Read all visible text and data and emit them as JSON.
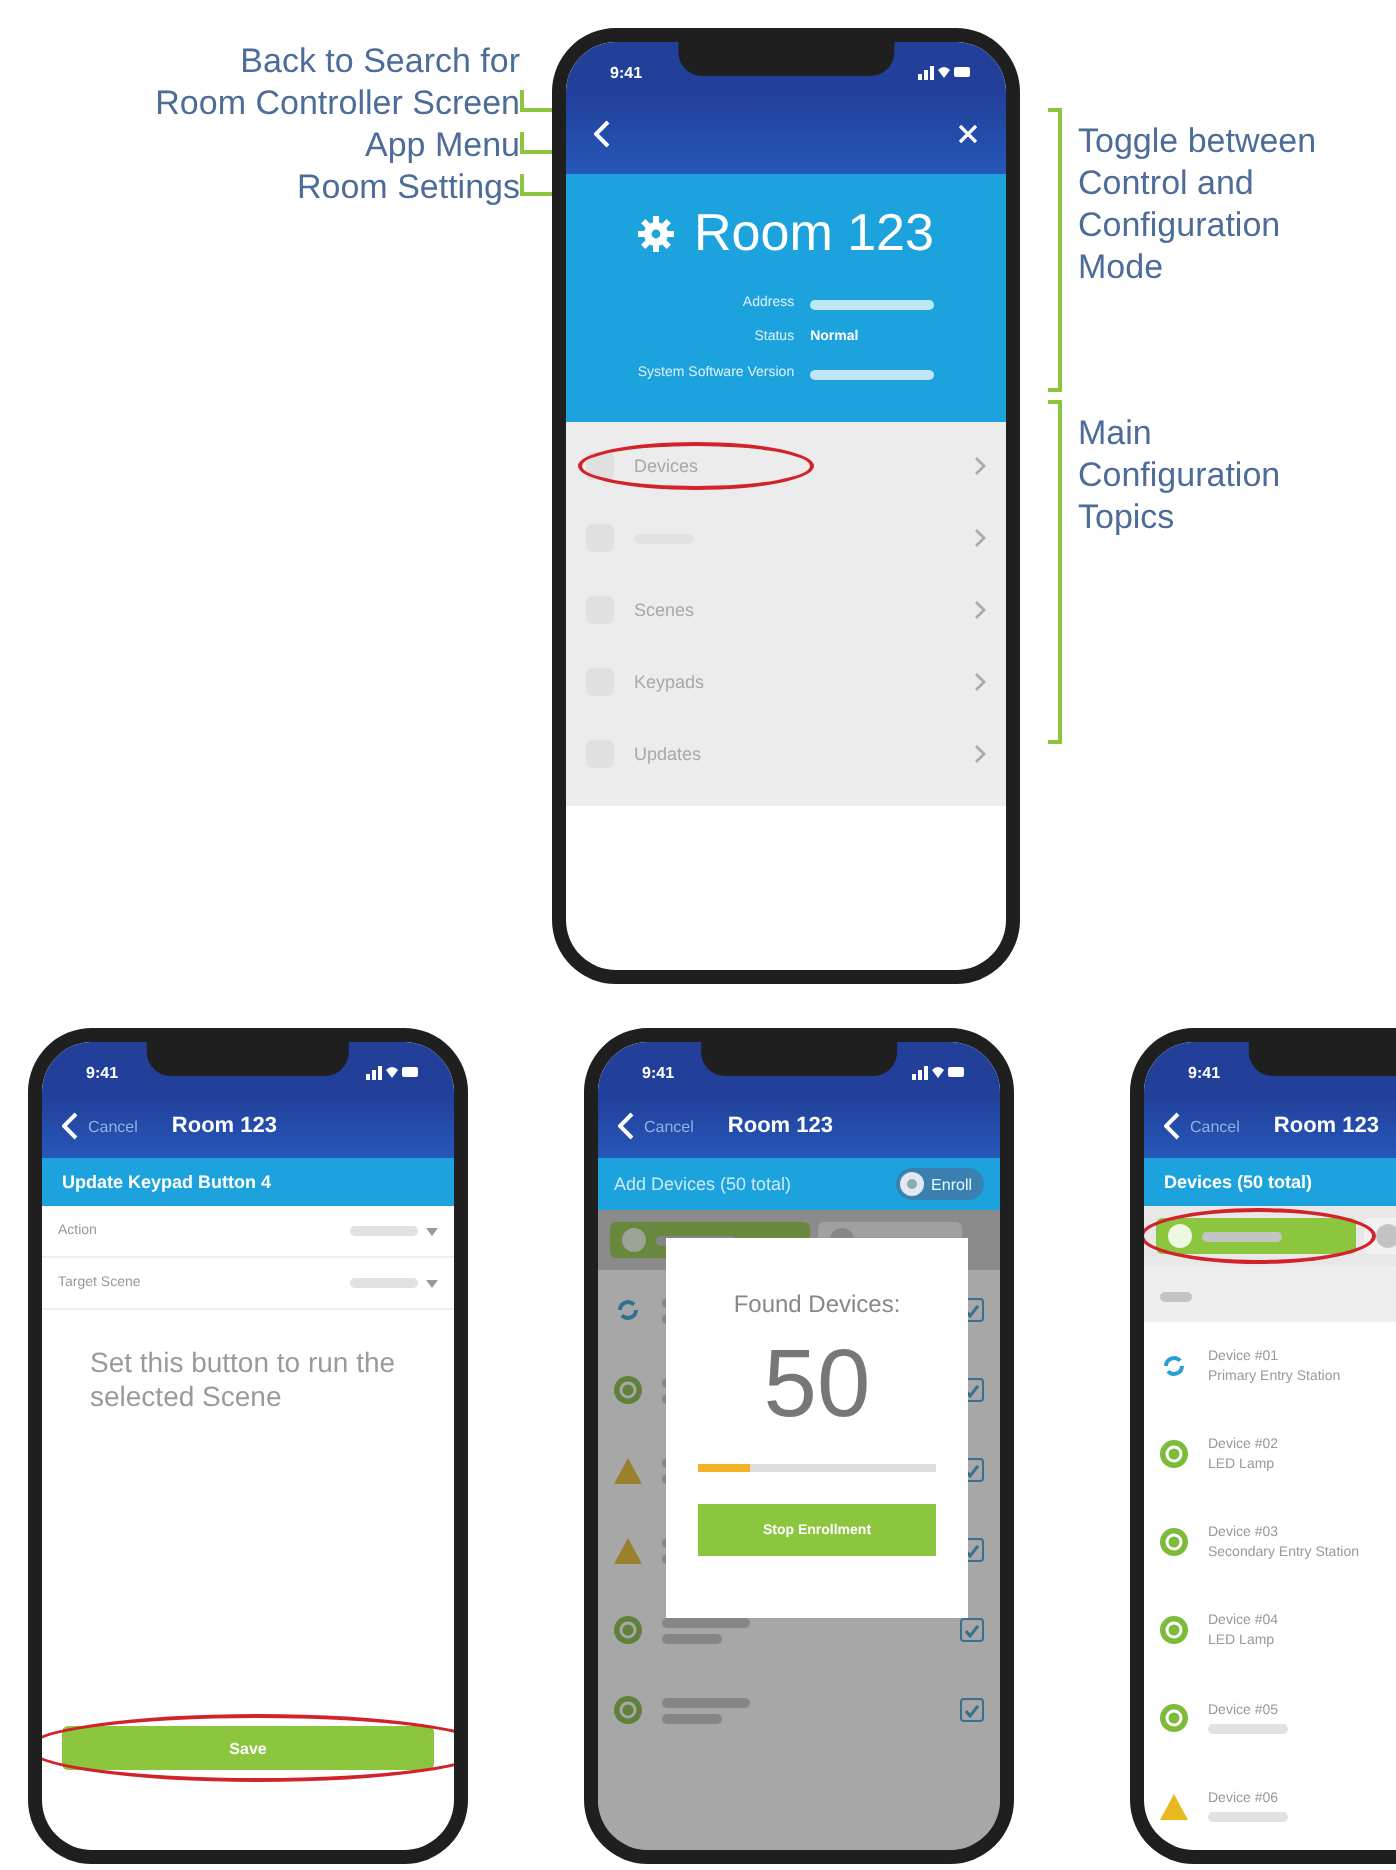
{
  "annotations_left": [
    {
      "text": "Back to Search for\nRoom Controller Screen"
    },
    {
      "text": "App Menu"
    },
    {
      "text": "Room Settings"
    }
  ],
  "annotations_right": [
    {
      "text": "Toggle between\nControl and\nConfiguration\nMode"
    },
    {
      "text": "Main\nConfiguration\nTopics"
    }
  ],
  "room_screen": {
    "time": "9:41",
    "title": "Room 123",
    "info": [
      {
        "label": "Address"
      },
      {
        "label": "Status",
        "value": "Normal"
      },
      {
        "label": "System Software Version"
      }
    ],
    "menu": [
      {
        "label": "Devices",
        "highlighted": true
      },
      {
        "highlighted": false
      },
      {
        "label": "Scenes",
        "highlighted": false
      },
      {
        "label": "Keypads",
        "highlighted": false
      },
      {
        "label": "Updates",
        "highlighted": false
      }
    ]
  },
  "keypad_screen": {
    "time": "9:41",
    "cancel": "Cancel",
    "title": "Room 123",
    "subtitle": "Update Keypad Button 4",
    "fields": [
      {
        "label": "Action"
      },
      {
        "label": "Target Scene"
      }
    ],
    "message": "Set this button to run the selected Scene",
    "button": {
      "label": "Save",
      "highlighted": true
    }
  },
  "enroll_screen": {
    "time": "9:41",
    "cancel": "Cancel",
    "title": "Room 123",
    "subtitle": "Add Devices (50 total)",
    "toggle": "Enroll",
    "rows": [
      {
        "kind": "sync",
        "checked": true
      },
      {
        "kind": "ok",
        "checked": true
      },
      {
        "kind": "warning",
        "checked": true
      },
      {
        "kind": "warning",
        "checked": true
      },
      {
        "kind": "ok",
        "checked": true
      },
      {
        "kind": "ok",
        "checked": true
      }
    ],
    "dialog": {
      "heading": "Found Devices:",
      "count": "50",
      "level": 0.22,
      "button": "Stop Enrollment"
    }
  },
  "devices_screen": {
    "time": "9:41",
    "cancel": "Cancel",
    "title": "Room 123",
    "subtitle": "Devices (50 total)",
    "toggle_highlighted": true,
    "devices": [
      {
        "kind": "sync",
        "name": "Device #01",
        "type": "Primary Entry Station"
      },
      {
        "kind": "ok",
        "name": "Device #02",
        "type": "LED Lamp"
      },
      {
        "kind": "ok",
        "name": "Device #03",
        "type": "Secondary Entry Station"
      },
      {
        "kind": "ok",
        "name": "Device #04",
        "type": "LED Lamp"
      },
      {
        "kind": "ok",
        "name": "Device #05"
      },
      {
        "kind": "warning",
        "name": "Device #06"
      }
    ]
  }
}
